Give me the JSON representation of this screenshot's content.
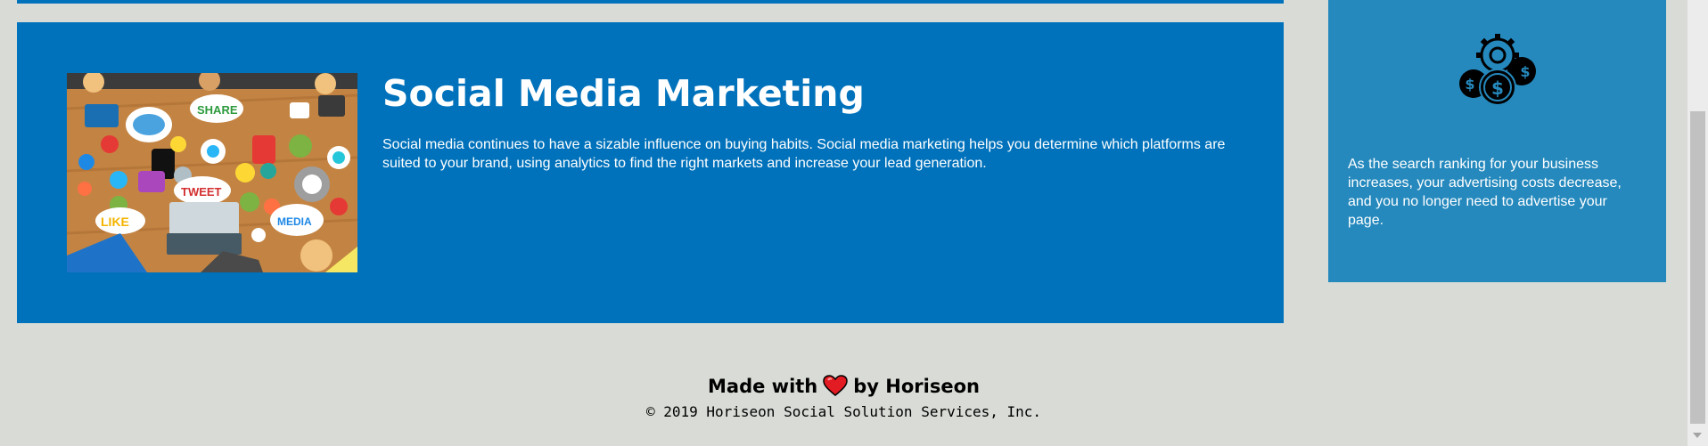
{
  "main_section": {
    "title": "Social Media Marketing",
    "description": "Social media continues to have a sizable influence on buying habits. Social media marketing helps you determine which platforms are suited to your brand, using analytics to find the right markets and increase your lead generation."
  },
  "sidebar": {
    "icon": "cost-management-icon",
    "text": "As the search ranking for your business increases, your advertising costs decrease, and you no longer need to advertise your page."
  },
  "footer": {
    "made_with": "Made with",
    "heart_icon": "heart-icon",
    "by": "by Horiseon",
    "copyright": "© 2019 Horiseon Social Solution Services, Inc."
  },
  "colors": {
    "background": "#d9dcd6",
    "section_blue": "#0072bb",
    "sidebar_blue": "#2589bd",
    "heart_red": "#e31b23"
  }
}
